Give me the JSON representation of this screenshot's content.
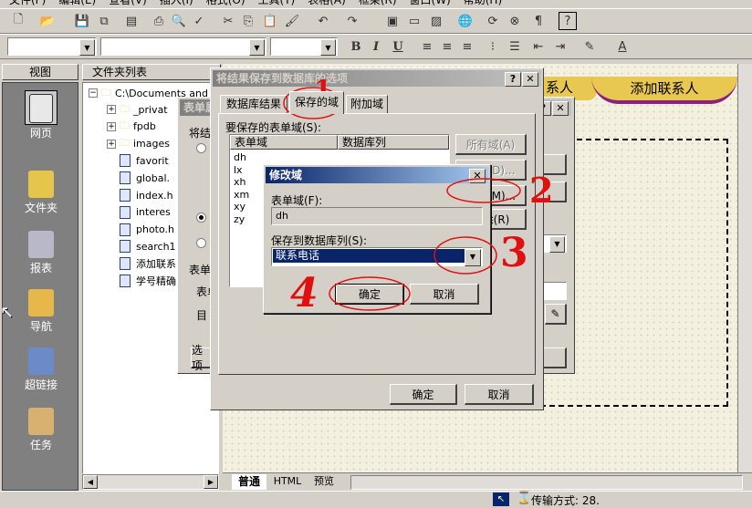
{
  "menubar": [
    "文件(F)",
    "编辑(E)",
    "查看(V)",
    "插入(I)",
    "格式(O)",
    "工具(T)",
    "表格(A)",
    "框架(R)",
    "窗口(W)",
    "帮助(H)"
  ],
  "views_panel": {
    "header": "视图",
    "items": [
      {
        "label": "网页",
        "icon": "page-icon"
      },
      {
        "label": "文件夹",
        "icon": "folder-icon"
      },
      {
        "label": "报表",
        "icon": "reports-icon"
      },
      {
        "label": "导航",
        "icon": "navigation-icon"
      },
      {
        "label": "超链接",
        "icon": "hyperlinks-icon"
      },
      {
        "label": "任务",
        "icon": "tasks-icon"
      }
    ]
  },
  "folder_panel": {
    "header": "文件夹列表",
    "root": "C:\\Documents and",
    "items": [
      "_privat",
      "fpdb",
      "images",
      "favorit",
      "global.",
      "index.h",
      "interes",
      "photo.h",
      "search1",
      "添加联系",
      "学号精确"
    ]
  },
  "background_page": {
    "banner_left": "系人",
    "banner_right": "添加联系人"
  },
  "background_dialog": {
    "title": "表单属",
    "label_a": "将结",
    "label_b": "表单",
    "label_c": "表单",
    "label_d": "目",
    "button_left": "选项"
  },
  "db_dialog": {
    "title": "将结果保存到数据库的选项",
    "tabs": [
      "数据库结果",
      "保存的域",
      "附加域"
    ],
    "list_label": "要保存的表单域(S):",
    "col_form_field": "表单域",
    "col_db_column": "数据库列",
    "rows": [
      "dh",
      "lx",
      "xh",
      "xm",
      "xy",
      "zy"
    ],
    "side_buttons": [
      "所有域(A)",
      "添加(D)...",
      "修改(M)...",
      "删除(R)"
    ],
    "ok": "确定",
    "cancel": "取消"
  },
  "modify_dialog": {
    "title": "修改域",
    "field_label": "表单域(F):",
    "field_value": "dh",
    "column_label": "保存到数据库列(S):",
    "column_value": "联系电话",
    "ok": "确定",
    "cancel": "取消"
  },
  "annotations": [
    "1",
    "2",
    "3",
    "4"
  ],
  "bottom_tabs": [
    "普通",
    "HTML",
    "预览"
  ],
  "status": {
    "transfer": "传输方式: 28."
  }
}
